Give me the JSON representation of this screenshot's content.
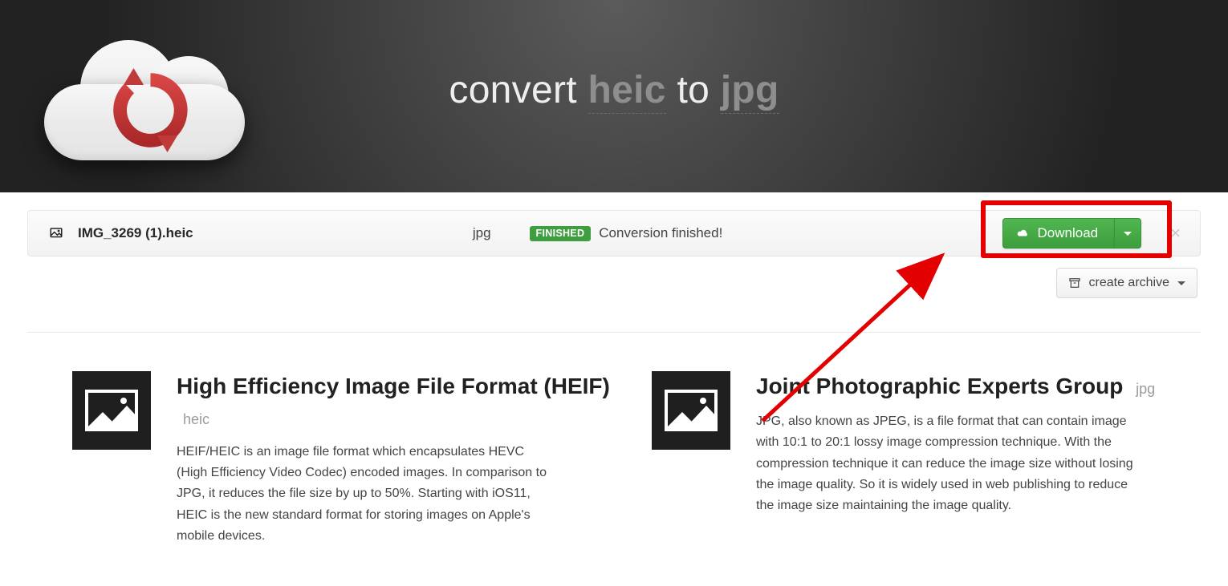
{
  "header": {
    "title_prefix": "convert",
    "from_format": "heic",
    "title_mid": "to",
    "to_format": "jpg"
  },
  "conversion": {
    "file_name": "IMG_3269 (1).heic",
    "output_ext": "jpg",
    "status_badge": "FINISHED",
    "status_text": "Conversion finished!",
    "download_label": "Download"
  },
  "archive": {
    "label": "create archive"
  },
  "info": {
    "left": {
      "title": "High Efficiency Image File Format (HEIF)",
      "sub": "heic",
      "body": "HEIF/HEIC is an image file format which encapsulates HEVC (High Efficiency Video Codec) encoded images. In comparison to JPG, it reduces the file size by up to 50%. Starting with iOS11, HEIC is the new standard format for storing images on Apple's mobile devices."
    },
    "right": {
      "title": "Joint Photographic Experts Group",
      "sub": "jpg",
      "body": "JPG, also known as JPEG, is a file format that can contain image with 10:1 to 20:1 lossy image compression technique. With the compression technique it can reduce the image size without losing the image quality. So it is widely used in web publishing to reduce the image size maintaining the image quality."
    }
  },
  "annotation": {
    "highlight_color": "#e20000"
  }
}
